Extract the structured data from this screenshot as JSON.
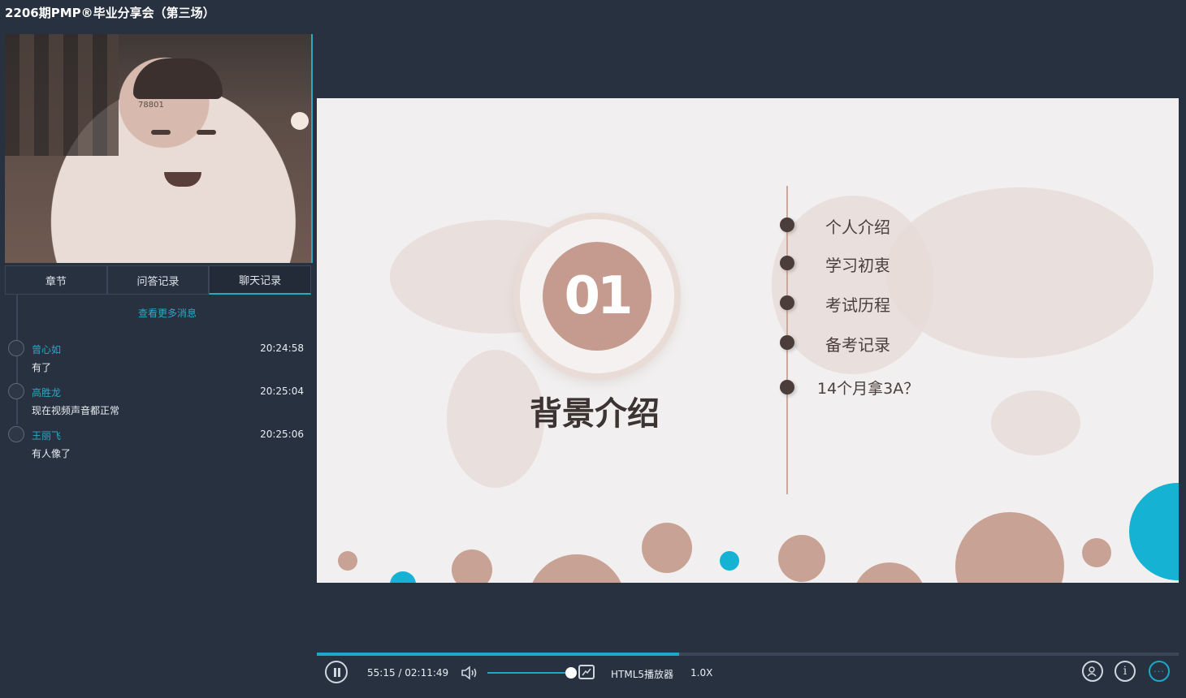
{
  "title": "2206期PMP®毕业分享会（第三场）",
  "webcam": {
    "overlay_text": "78801"
  },
  "tabs": [
    {
      "label": "章节",
      "active": false
    },
    {
      "label": "问答记录",
      "active": false
    },
    {
      "label": "聊天记录",
      "active": true
    }
  ],
  "chat": {
    "more_label": "查看更多消息",
    "messages": [
      {
        "name": "曾心如",
        "time": "20:24:58",
        "text": "有了"
      },
      {
        "name": "高胜龙",
        "time": "20:25:04",
        "text": "现在视频声音都正常"
      },
      {
        "name": "王丽飞",
        "time": "20:25:06",
        "text": "有人像了"
      }
    ]
  },
  "slide": {
    "number": "01",
    "heading": "背景介绍",
    "agenda": [
      "个人介绍",
      "学习初衷",
      "考试历程",
      "备考记录",
      "14个月拿3A？"
    ],
    "accent_peach": "#c8a295",
    "accent_cyan": "#15b2d3"
  },
  "player": {
    "progress": 0.42,
    "timecode": "55:15 / 02:11:49",
    "volume": 1.0,
    "player_name": "HTML5播放器",
    "speed": "1.0X",
    "icons": [
      "pause-icon",
      "volume-icon",
      "picture-in-picture-icon",
      "user-question-icon",
      "info-icon",
      "more-icon"
    ]
  }
}
